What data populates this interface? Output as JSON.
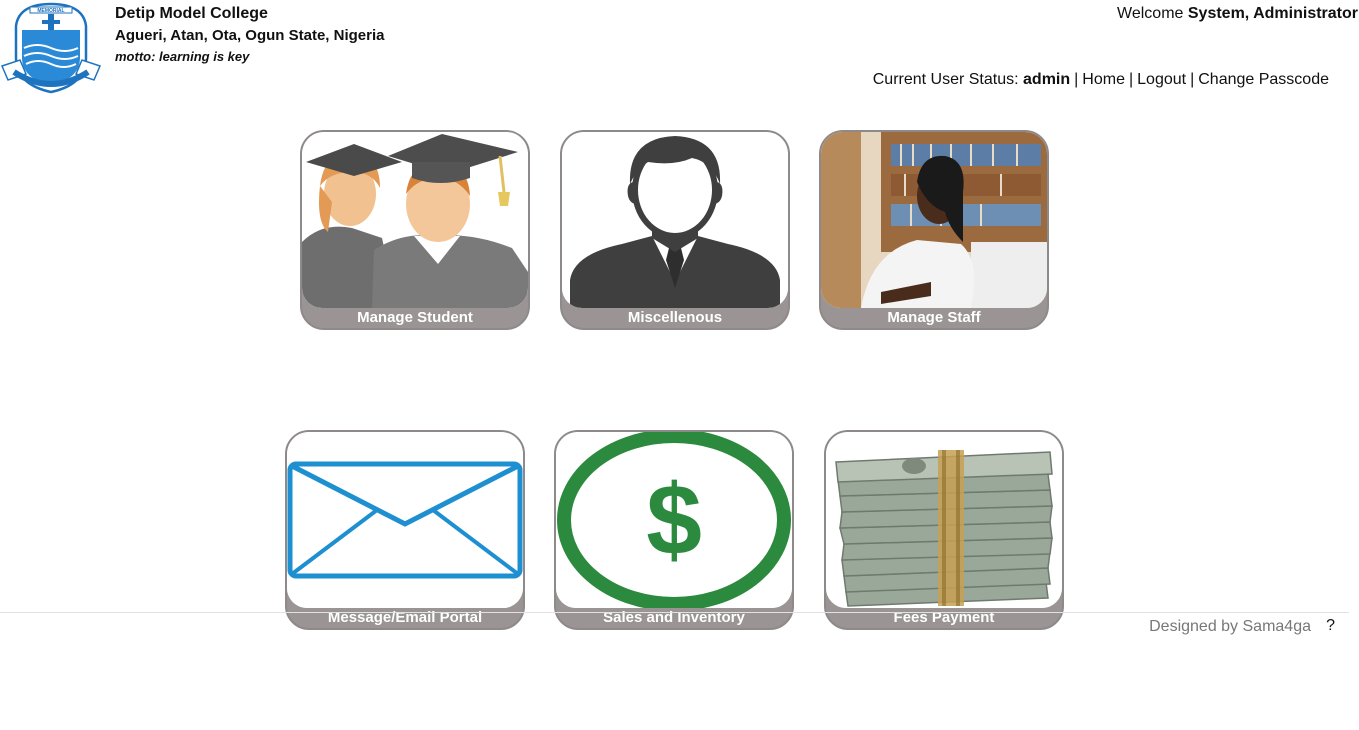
{
  "header": {
    "school_name": "Detip Model College",
    "address": "Agueri, Atan, Ota, Ogun State, Nigeria",
    "motto": "motto: learning is key",
    "logo_text": "MEMORIAL"
  },
  "user": {
    "welcome_prefix": "Welcome ",
    "name": "System, Administrator",
    "status_prefix": "Current User Status: ",
    "status": "admin",
    "links": [
      "Home",
      "Logout",
      "Change Passcode"
    ],
    "separator": "|"
  },
  "tiles": [
    {
      "label": "Manage Student",
      "icon": "graduates-icon"
    },
    {
      "label": "Miscellenous",
      "icon": "person-silhouette-icon"
    },
    {
      "label": "Manage Staff",
      "icon": "staff-photo-icon"
    },
    {
      "label": "Message/Email Portal",
      "icon": "envelope-icon"
    },
    {
      "label": "Sales and Inventory",
      "icon": "dollar-circle-icon"
    },
    {
      "label": "Fees Payment",
      "icon": "money-stack-icon"
    }
  ],
  "footer": {
    "designed_by": "Designed by Sama4ga",
    "help": "?"
  },
  "colors": {
    "tile_border": "#8f8a8a",
    "tile_label_bg": "#9a9494",
    "envelope": "#1e8fd0",
    "dollar": "#2b8a3e"
  }
}
